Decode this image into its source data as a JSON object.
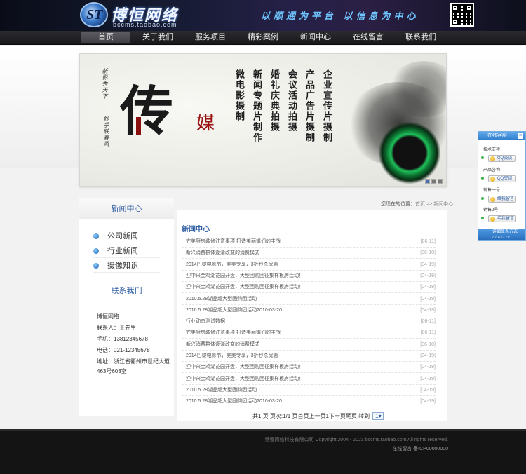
{
  "header": {
    "logo_cn": "博恒网络",
    "logo_en": "bccms.taobao.com",
    "logo_mark": "ST",
    "slogan": "以顺通为平台 以信息为中心"
  },
  "nav": {
    "items": [
      "首页",
      "关于我们",
      "服务项目",
      "精彩案例",
      "新闻中心",
      "在线留言",
      "联系我们"
    ],
    "active_index": 0
  },
  "banner": {
    "big_char": "传",
    "red_char": "媒",
    "small_vertical_1": "新影秀天下",
    "small_vertical_2": "妙手映春风",
    "columns": [
      "企业宣传片摄制",
      "产品广告片摄制",
      "会议活动拍摄",
      "婚礼庆典拍摄",
      "新闻专题片制作",
      "微电影摄制"
    ]
  },
  "sidebar": {
    "title": "新闻中心",
    "links": [
      "公司新闻",
      "行业新闻",
      "摄像知识"
    ],
    "contact_title": "联系我们",
    "contact": {
      "company": "博恒网络",
      "person": "联系人：王先生",
      "mobile": "手机：13812345678",
      "phone": "电话：021-12345678",
      "address": "地址：浙江省衢州市世纪大道463号603室"
    }
  },
  "breadcrumb": {
    "prefix": "您现在的位置：",
    "path": "首页 >> 新闻中心"
  },
  "main": {
    "title": "新闻中心",
    "news": [
      {
        "title": "完美厨房装修注意事项 打造美丽婚们的主战",
        "date": "[06-11]"
      },
      {
        "title": "新兴消费群体逐渐改变的消费模式",
        "date": "[06-10]"
      },
      {
        "title": "2014巴黎电影节，美美专享，3折秒杀优惠",
        "date": "[04-19]"
      },
      {
        "title": "迎中兴金鸡湖花园开盘，大型团购团征集样板房活动！",
        "date": "[04-19]"
      },
      {
        "title": "迎中兴金鸡湖花园开盘，大型团购团征集样板房活动！",
        "date": "[04-19]"
      },
      {
        "title": "2010.5.28湖品超大型团购团活动",
        "date": "[04-19]"
      },
      {
        "title": "2010.5.28湖品超大型团购团活动2010-03-20",
        "date": "[04-19]"
      },
      {
        "title": "行业动态测试数据",
        "date": "[06-11]"
      },
      {
        "title": "完美厨房装修注意事项 打造美丽婚们的主战",
        "date": "[06-11]"
      },
      {
        "title": "新兴消费群体逐渐改变的消费模式",
        "date": "[06-10]"
      },
      {
        "title": "2014巴黎电影节，美美专享，3折秒杀优惠",
        "date": "[04-19]"
      },
      {
        "title": "迎中兴金鸡湖花园开盘，大型团购团征集样板房活动！",
        "date": "[04-19]"
      },
      {
        "title": "迎中兴金鸡湖花园开盘，大型团购团征集样板房活动！",
        "date": "[04-19]"
      },
      {
        "title": "2010.5.28湖品超大型团购团活动",
        "date": "[04-19]"
      },
      {
        "title": "2010.5.28湖品超大型团购团活动2010-03-20",
        "date": "[04-19]"
      }
    ],
    "pager": {
      "text": "共1 页 页次:1/1 页首页上一页1下一页尾页 转到",
      "goto_value": "1"
    }
  },
  "footer": {
    "copyright": "博恒网络科技有限公司 Copyright 2004 - 2021 bccms.taobao.com All rights reserved.",
    "icp": "在线留言  备ICP00000000"
  },
  "float_panel": {
    "title": "在线客服",
    "close": "×",
    "groups": [
      {
        "label": "技术支持",
        "button": "QQ交谈"
      },
      {
        "label": "产品咨询",
        "button": "QQ交谈"
      },
      {
        "label": "销售一号",
        "button": "给我留言"
      },
      {
        "label": "销售2号",
        "button": "给我留言"
      }
    ],
    "footer_cn": "详细联系方式",
    "footer_en": "CONTACT"
  },
  "colors": {
    "accent": "#2a5aa0",
    "nav_bg": "#1c1c1f",
    "footer_bg": "#141414",
    "banner_red": "#9a1111"
  }
}
